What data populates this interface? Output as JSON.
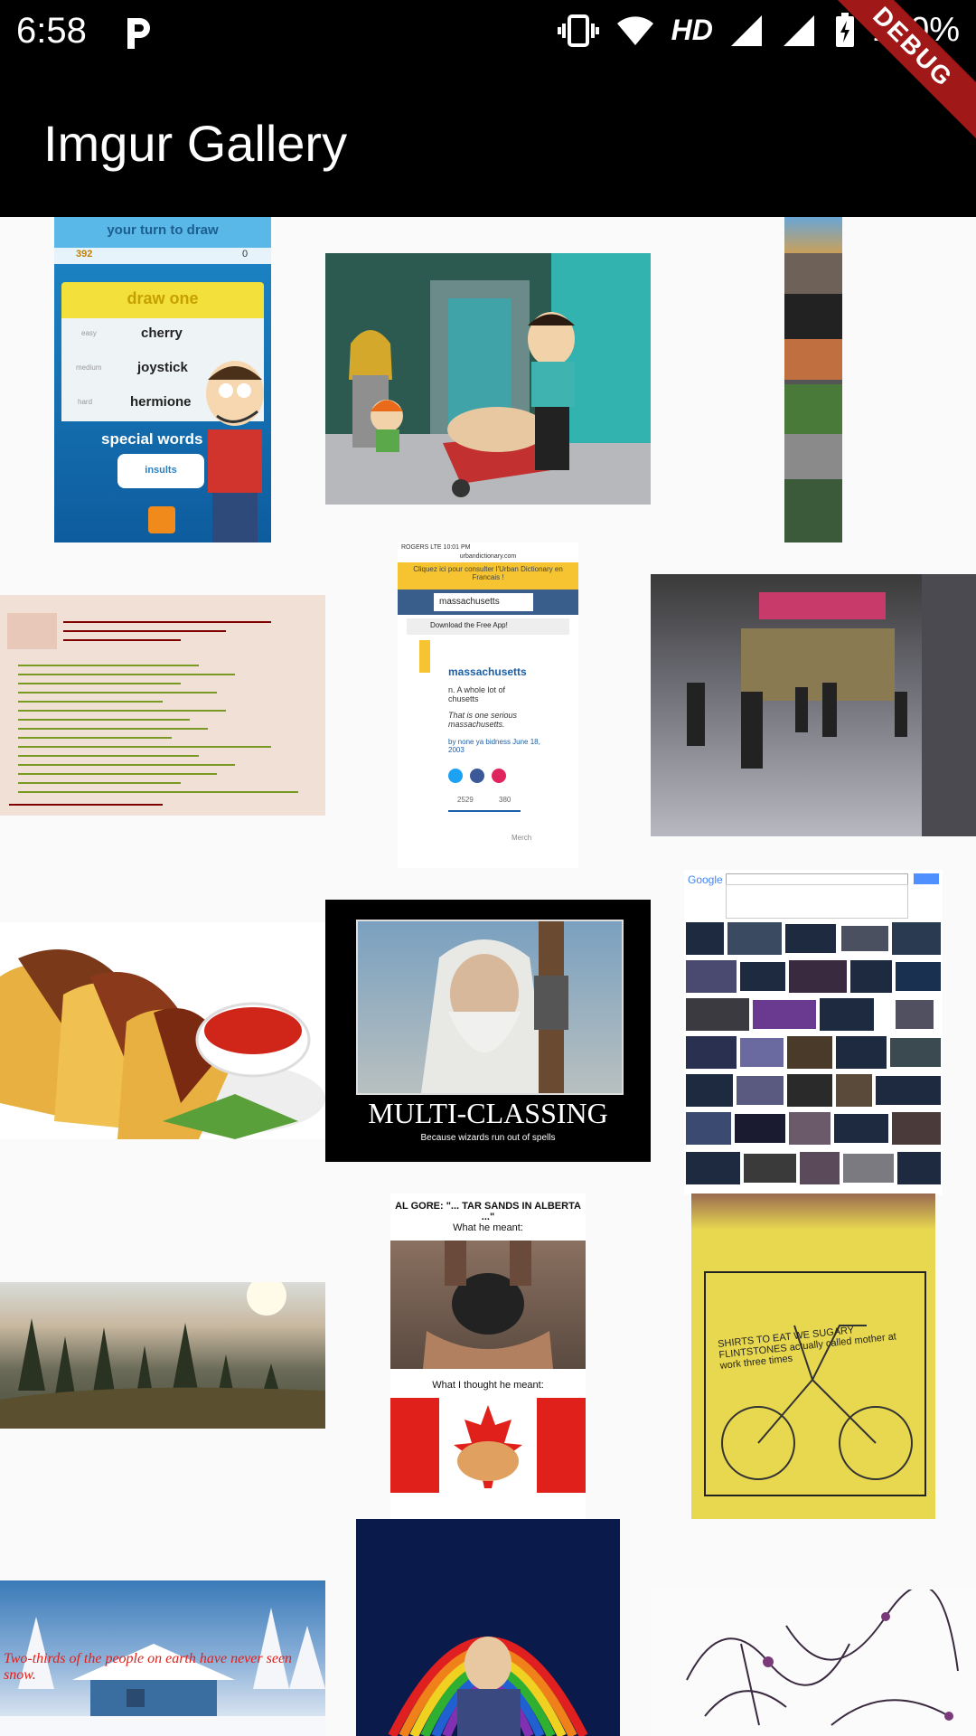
{
  "status": {
    "time": "6:58",
    "network": "HD",
    "battery": "100%"
  },
  "app": {
    "title": "Imgur Gallery"
  },
  "debug_banner": "DEBUG",
  "images": {
    "draw": {
      "header": "your turn to draw",
      "coins": "392",
      "bombs": "0",
      "prompt": "draw one",
      "words": [
        {
          "level": "easy",
          "word": "cherry"
        },
        {
          "level": "medium",
          "word": "joystick"
        },
        {
          "level": "hard",
          "word": "hermione"
        }
      ],
      "special": "special words",
      "insults": "insults"
    },
    "ud": {
      "status": "ROGERS LTE 10:01 PM",
      "url": "urbandictionary.com",
      "banner": "Cliquez ici pour consulter l'Urban Dictionary en Francais !",
      "search": "massachusetts",
      "app_prompt": "Download the Free App!",
      "word": "massachusetts",
      "definition": "n. A whole lot of chusetts",
      "example": "That is one serious massachusetts.",
      "byline": "by none ya bidness June 18, 2003",
      "up": "2529",
      "down": "380",
      "merch": "Merch"
    },
    "gandalf": {
      "title": "MULTI-CLASSING",
      "subtitle": "Because wizards run out of spells"
    },
    "algore": {
      "title": "AL GORE: \"... TAR SANDS IN ALBERTA ...\"",
      "meant": "What he meant:",
      "thought": "What I thought he meant:"
    },
    "shirt": {
      "text": "SHIRTS TO EAT WE SUGARY FLINTSTONES actually called mother at work three times"
    },
    "snow": {
      "caption": "Two-thirds of the people on earth have never seen snow."
    },
    "google": {
      "logo": "Google"
    }
  }
}
